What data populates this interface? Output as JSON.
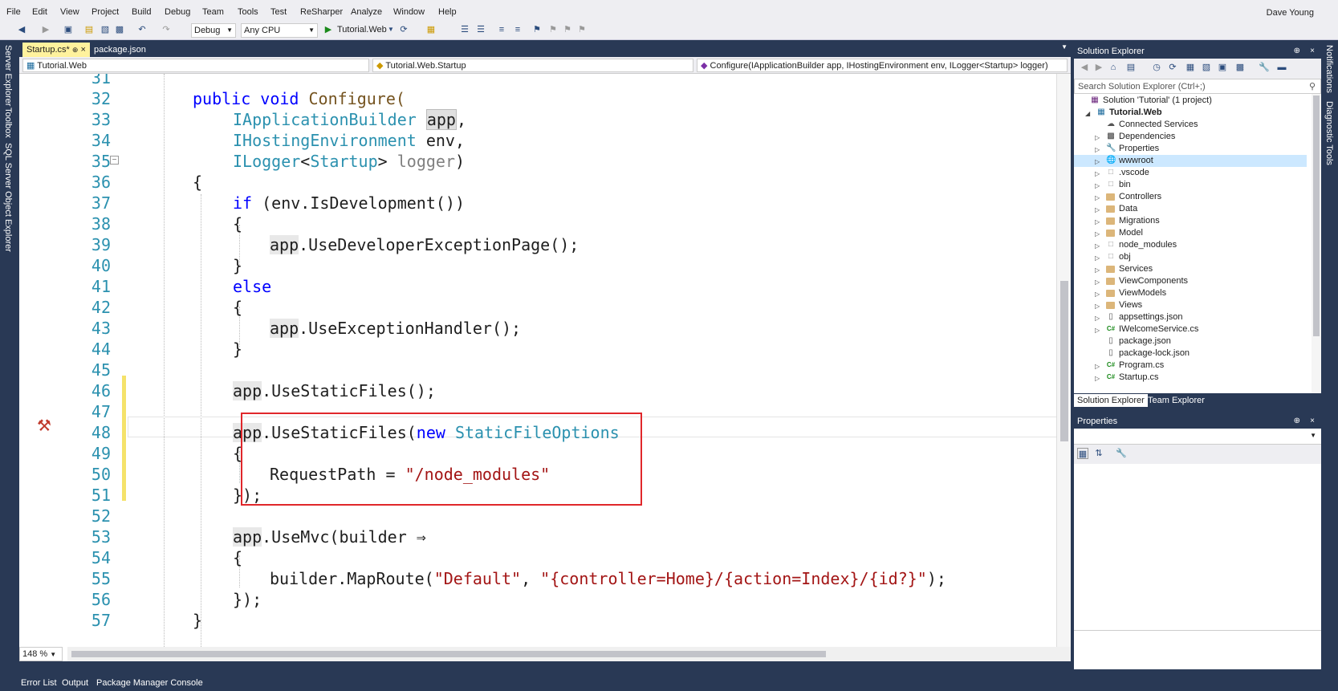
{
  "menu": [
    "File",
    "Edit",
    "View",
    "Project",
    "Build",
    "Debug",
    "Team",
    "Tools",
    "Test",
    "ReSharper",
    "Analyze",
    "Window",
    "Help"
  ],
  "user": "Dave Young",
  "toolbar": {
    "config": "Debug",
    "platform": "Any CPU",
    "run_target": "Tutorial.Web"
  },
  "left_panels": [
    "Server Explorer",
    "Toolbox",
    "SQL Server Object Explorer"
  ],
  "right_panels": [
    "Notifications",
    "Diagnostic Tools"
  ],
  "doc_tabs": [
    {
      "label": "Startup.cs*",
      "active": true
    },
    {
      "label": "package.json",
      "active": false
    }
  ],
  "nav": {
    "project": "Tutorial.Web",
    "type": "Tutorial.Web.Startup",
    "member": "Configure(IApplicationBuilder app, IHostingEnvironment env, ILogger<Startup> logger)"
  },
  "code_lines": [
    31,
    32,
    33,
    34,
    35,
    36,
    37,
    38,
    39,
    40,
    41,
    42,
    43,
    44,
    45,
    46,
    47,
    48,
    49,
    50,
    51,
    52,
    53,
    54,
    55,
    56,
    57
  ],
  "code": {
    "l32_kw": "public void",
    "l32_name": "Configure(",
    "l33_type": "IApplicationBuilder",
    "l33_param": "app",
    "l34_type": "IHostingEnvironment",
    "l34_param": "env,",
    "l35_type": "ILogger",
    "l35_gen": "Startup",
    "l35_param": "logger",
    "brace_open": "{",
    "brace_close": "}",
    "l37_kw": "if",
    "l37_rest": "(env.IsDevelopment())",
    "app": "app",
    "l39_call": ".UseDeveloperExceptionPage();",
    "l41_kw": "else",
    "l43_call": ".UseExceptionHandler();",
    "l46_call": ".UseStaticFiles();",
    "l48_call": ".UseStaticFiles(",
    "l48_kw": "new",
    "l48_type": "StaticFileOptions",
    "l50_prop": "RequestPath = ",
    "l50_str": "\"/node_modules\"",
    "l51": "});",
    "l53_call": ".UseMvc(builder ⇒",
    "l55_call": "builder.MapRoute(",
    "l55_str1": "\"Default\"",
    "l55_str2": "\"{controller=Home}/{action=Index}/{id?}\"",
    "l55_end": ");",
    "l56": "});"
  },
  "zoom": "148 %",
  "status_tabs": [
    "Error List",
    "Output",
    "Package Manager Console"
  ],
  "solution_explorer": {
    "title": "Solution Explorer",
    "search_placeholder": "Search Solution Explorer (Ctrl+;)",
    "items": [
      {
        "label": "Solution 'Tutorial' (1 project)",
        "level": 0,
        "expander": "",
        "icon": "solution"
      },
      {
        "label": "Tutorial.Web",
        "level": 1,
        "expander": "open",
        "icon": "project",
        "bold": true
      },
      {
        "label": "Connected Services",
        "level": 2,
        "expander": "",
        "icon": "cloud"
      },
      {
        "label": "Dependencies",
        "level": 2,
        "expander": "closed",
        "icon": "deps"
      },
      {
        "label": "Properties",
        "level": 2,
        "expander": "closed",
        "icon": "wrench"
      },
      {
        "label": "wwwroot",
        "level": 2,
        "expander": "closed",
        "icon": "globe",
        "selected": true
      },
      {
        "label": ".vscode",
        "level": 2,
        "expander": "closed",
        "icon": "folder-empty"
      },
      {
        "label": "bin",
        "level": 2,
        "expander": "closed",
        "icon": "folder-empty"
      },
      {
        "label": "Controllers",
        "level": 2,
        "expander": "closed",
        "icon": "folder"
      },
      {
        "label": "Data",
        "level": 2,
        "expander": "closed",
        "icon": "folder"
      },
      {
        "label": "Migrations",
        "level": 2,
        "expander": "closed",
        "icon": "folder"
      },
      {
        "label": "Model",
        "level": 2,
        "expander": "closed",
        "icon": "folder"
      },
      {
        "label": "node_modules",
        "level": 2,
        "expander": "closed",
        "icon": "folder-empty"
      },
      {
        "label": "obj",
        "level": 2,
        "expander": "closed",
        "icon": "folder-empty"
      },
      {
        "label": "Services",
        "level": 2,
        "expander": "closed",
        "icon": "folder"
      },
      {
        "label": "ViewComponents",
        "level": 2,
        "expander": "closed",
        "icon": "folder"
      },
      {
        "label": "ViewModels",
        "level": 2,
        "expander": "closed",
        "icon": "folder"
      },
      {
        "label": "Views",
        "level": 2,
        "expander": "closed",
        "icon": "folder"
      },
      {
        "label": "appsettings.json",
        "level": 2,
        "expander": "closed",
        "icon": "json"
      },
      {
        "label": "IWelcomeService.cs",
        "level": 2,
        "expander": "closed",
        "icon": "cs"
      },
      {
        "label": "package.json",
        "level": 2,
        "expander": "",
        "icon": "json"
      },
      {
        "label": "package-lock.json",
        "level": 2,
        "expander": "",
        "icon": "json"
      },
      {
        "label": "Program.cs",
        "level": 2,
        "expander": "closed",
        "icon": "cs"
      },
      {
        "label": "Startup.cs",
        "level": 2,
        "expander": "closed",
        "icon": "cs"
      }
    ],
    "tabs": [
      "Solution Explorer",
      "Team Explorer"
    ]
  },
  "properties": {
    "title": "Properties"
  },
  "colors": {
    "accent": "#293955",
    "highlight_box": "#e0272b",
    "change_bar": "#f5e26a",
    "selected_row": "#cce8ff"
  }
}
